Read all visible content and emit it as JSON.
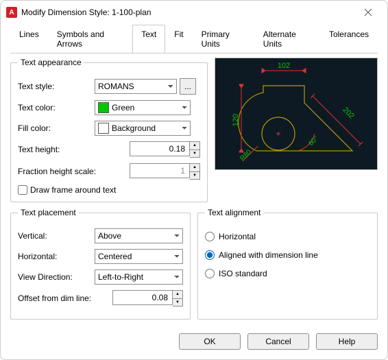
{
  "window": {
    "title": "Modify Dimension Style: 1-100-plan"
  },
  "tabs": [
    "Lines",
    "Symbols and Arrows",
    "Text",
    "Fit",
    "Primary Units",
    "Alternate Units",
    "Tolerances"
  ],
  "activeTab": "Text",
  "appearance": {
    "legend": "Text appearance",
    "style_label": "Text style:",
    "style_value": "ROMANS",
    "browse": "...",
    "color_label": "Text color:",
    "color_value": "Green",
    "color_hex": "#00c800",
    "fill_label": "Fill color:",
    "fill_value": "Background",
    "height_label": "Text height:",
    "height_value": "0.18",
    "fraction_label": "Fraction height scale:",
    "fraction_value": "1",
    "frame_label": "Draw frame around text"
  },
  "placement": {
    "legend": "Text placement",
    "vertical_label": "Vertical:",
    "vertical_value": "Above",
    "horizontal_label": "Horizontal:",
    "horizontal_value": "Centered",
    "viewdir_label": "View Direction:",
    "viewdir_value": "Left-to-Right",
    "offset_label": "Offset from dim line:",
    "offset_value": "0.08"
  },
  "alignment": {
    "legend": "Text alignment",
    "opt1": "Horizontal",
    "opt2": "Aligned with dimension line",
    "opt3": "ISO standard",
    "selected": "opt2"
  },
  "preview": {
    "dim_top": "102",
    "dim_left": "120",
    "dim_diag": "202",
    "dim_angle": "60°",
    "dim_radius": "R80"
  },
  "buttons": {
    "ok": "OK",
    "cancel": "Cancel",
    "help": "Help"
  }
}
